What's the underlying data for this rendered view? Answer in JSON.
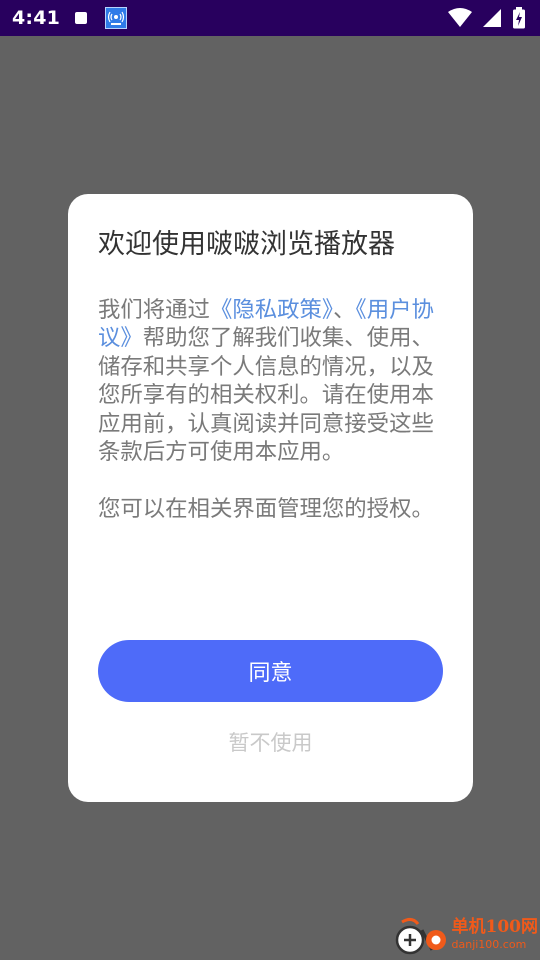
{
  "status_bar": {
    "time": "4:41",
    "icons": [
      "notification-square-icon",
      "broadcast-app-icon",
      "wifi-icon",
      "cell-signal-icon",
      "battery-icon"
    ]
  },
  "dialog": {
    "title": "欢迎使用啵啵浏览播放器",
    "body": {
      "p1_before_link1": "我们将通过",
      "link1": "《隐私政策》",
      "sep": "、",
      "link2": "《用户协议》",
      "p1_after": "帮助您了解我们收集、使用、储存和共享个人信息的情况，以及您所享有的相关权利。请在使用本应用前，认真阅读并同意接受这些条款后方可使用本应用。",
      "p2": "您可以在相关界面管理您的授权。"
    },
    "agree_label": "同意",
    "decline_label": "暂不使用"
  },
  "watermark": {
    "cn": "单机100网",
    "url": "danji100.com"
  },
  "colors": {
    "status_bar": "#28005e",
    "overlay": "#626262",
    "primary_button": "#4e6bf9",
    "link": "#5b8fde",
    "watermark": "#f05a1a"
  }
}
